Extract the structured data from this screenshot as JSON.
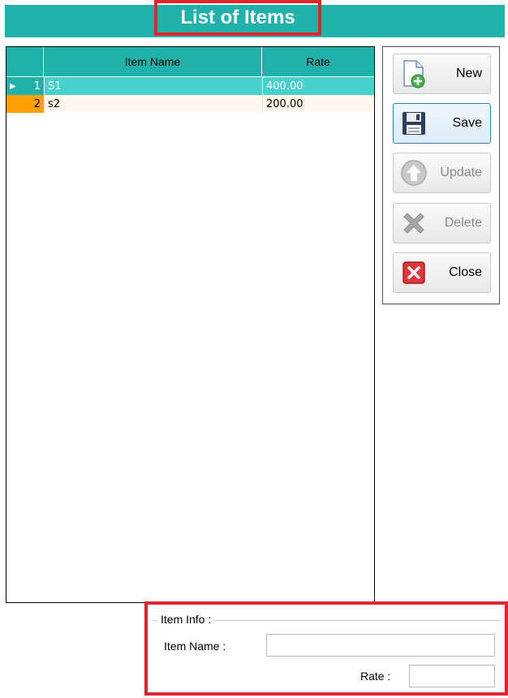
{
  "header": {
    "title": "List of Items"
  },
  "grid": {
    "columns": [
      "Item Name",
      "Rate"
    ],
    "rows": [
      {
        "index": "1",
        "name": "S1",
        "rate": "400.00",
        "selected": true
      },
      {
        "index": "2",
        "name": "s2",
        "rate": "200.00",
        "selected": false
      }
    ],
    "current_row_marker": "▶"
  },
  "buttons": {
    "new": "New",
    "save": "Save",
    "update": "Update",
    "delete": "Delete",
    "close": "Close"
  },
  "item_info": {
    "legend": "Item Info :",
    "item_name_label": "Item Name :",
    "item_name_value": "",
    "rate_label": "Rate :",
    "rate_value": ""
  },
  "colors": {
    "accent": "#20b2aa",
    "selection": "#48d1cc",
    "row_header_alt": "#ff9f00",
    "highlight_border": "#e0242c"
  }
}
